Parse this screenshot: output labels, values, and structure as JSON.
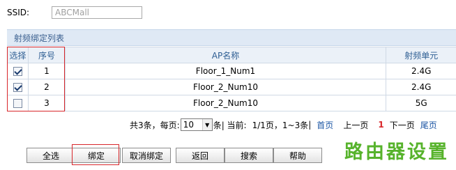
{
  "ssid": {
    "label": "SSID:",
    "value": "ABCMall"
  },
  "panel": {
    "title": "射频绑定列表"
  },
  "table": {
    "headers": {
      "select": "选择",
      "index": "序号",
      "ap_name": "AP名称",
      "radio": "射频单元"
    },
    "rows": [
      {
        "checked": true,
        "index": "1",
        "ap_name": "Floor_1_Num1",
        "radio": "2.4G"
      },
      {
        "checked": true,
        "index": "2",
        "ap_name": "Floor_2_Num10",
        "radio": "2.4G"
      },
      {
        "checked": false,
        "index": "3",
        "ap_name": "Floor_2_Num10",
        "radio": "5G"
      }
    ]
  },
  "pager": {
    "total_prefix": "共3条，每页:",
    "per_page": "10",
    "per_page_suffix": "条",
    "current_label": "| 当前:",
    "page_info": "1/1页，1~3条",
    "sep": "|",
    "first": "首页",
    "prev": "上一页",
    "current_page": "1",
    "next": "下一页",
    "last": "尾页"
  },
  "buttons": {
    "select_all": "全选",
    "bind": "绑定",
    "unbind": "取消绑定",
    "back": "返回",
    "search": "搜索",
    "help": "帮助"
  },
  "watermark": "路由器设置",
  "colors": {
    "highlight": "#d8262a",
    "link": "#1a54a3",
    "header_bg": "#dfe9f5",
    "watermark": "#57b32c"
  }
}
